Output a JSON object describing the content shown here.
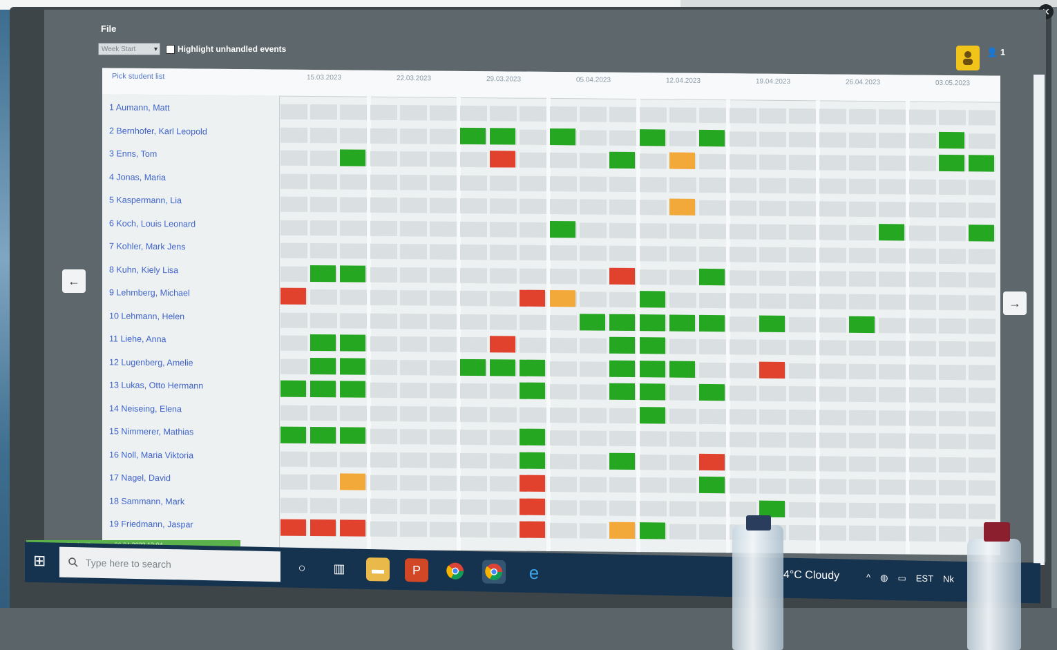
{
  "app": {
    "title": "File",
    "dropdown_value": "Week Start",
    "highlight_label": "Highlight unhandled events",
    "user_count": "1"
  },
  "grid": {
    "corner_label": "Pick student list",
    "dates": [
      "15.03.2023",
      "22.03.2023",
      "29.03.2023",
      "05.04.2023",
      "12.04.2023",
      "19.04.2023",
      "26.04.2023",
      "03.05.2023"
    ],
    "students": [
      {
        "label": "1  Aumann, Matt"
      },
      {
        "label": "2  Bernhofer, Karl Leopold"
      },
      {
        "label": "3  Enns, Tom"
      },
      {
        "label": "4  Jonas, Maria"
      },
      {
        "label": "5  Kaspermann, Lia"
      },
      {
        "label": "6  Koch, Louis Leonard"
      },
      {
        "label": "7  Kohler, Mark Jens"
      },
      {
        "label": "8  Kuhn, Kiely Lisa"
      },
      {
        "label": "9  Lehmberg, Michael"
      },
      {
        "label": "10  Lehmann, Helen"
      },
      {
        "label": "11  Liehe, Anna"
      },
      {
        "label": "12  Lugenberg, Amelie"
      },
      {
        "label": "13  Lukas, Otto Hermann"
      },
      {
        "label": "14  Neiseing, Elena"
      },
      {
        "label": "15  Nimmerer, Mathias"
      },
      {
        "label": "16  Noll, Maria Viktoria"
      },
      {
        "label": "17  Nagel, David"
      },
      {
        "label": "18  Sammann, Mark"
      },
      {
        "label": "19  Friedmann, Jaspar"
      }
    ],
    "events": [
      [],
      [
        [
          "green",
          6
        ],
        [
          "green",
          7
        ],
        [
          "green",
          9
        ],
        [
          "green",
          9
        ],
        [
          "green",
          12
        ],
        [
          "green",
          14
        ],
        [
          "green",
          22
        ]
      ],
      [
        [
          "green",
          2
        ],
        [
          "red",
          7
        ],
        [
          "red",
          7
        ],
        [
          "green",
          11
        ],
        [
          "orange",
          13
        ],
        [
          "green",
          22
        ],
        [
          "green",
          23
        ]
      ],
      [],
      [
        [
          "orange",
          13
        ]
      ],
      [
        [
          "green",
          9
        ],
        [
          "green",
          20
        ],
        [
          "green",
          23
        ]
      ],
      [],
      [
        [
          "green",
          1
        ],
        [
          "green",
          2
        ],
        [
          "red",
          11
        ],
        [
          "green",
          14
        ]
      ],
      [
        [
          "red",
          0
        ],
        [
          "red",
          8
        ],
        [
          "orange",
          9
        ],
        [
          "green",
          12
        ]
      ],
      [
        [
          "green",
          10
        ],
        [
          "green",
          11
        ],
        [
          "green",
          12
        ],
        [
          "green",
          13
        ],
        [
          "green",
          14
        ],
        [
          "green",
          16
        ],
        [
          "green",
          19
        ]
      ],
      [
        [
          "green",
          1
        ],
        [
          "green",
          2
        ],
        [
          "red",
          7
        ],
        [
          "green",
          11
        ],
        [
          "green",
          12
        ]
      ],
      [
        [
          "green",
          1
        ],
        [
          "green",
          2
        ],
        [
          "green",
          6
        ],
        [
          "green",
          7
        ],
        [
          "green",
          8
        ],
        [
          "green",
          11
        ],
        [
          "green",
          12
        ],
        [
          "green",
          13
        ],
        [
          "red",
          16
        ]
      ],
      [
        [
          "green",
          0
        ],
        [
          "green",
          1
        ],
        [
          "green",
          2
        ],
        [
          "green",
          8
        ],
        [
          "green",
          11
        ],
        [
          "green",
          12
        ],
        [
          "green",
          14
        ]
      ],
      [
        [
          "green",
          12
        ]
      ],
      [
        [
          "green",
          0
        ],
        [
          "green",
          1
        ],
        [
          "green",
          2
        ],
        [
          "green",
          8
        ]
      ],
      [
        [
          "green",
          8
        ],
        [
          "green",
          11
        ],
        [
          "red",
          14
        ]
      ],
      [
        [
          "orange",
          2
        ],
        [
          "red",
          8
        ],
        [
          "green",
          14
        ]
      ],
      [
        [
          "red",
          8
        ],
        [
          "green",
          16
        ]
      ],
      [
        [
          "red",
          0
        ],
        [
          "red",
          1
        ],
        [
          "red",
          2
        ],
        [
          "red",
          8
        ],
        [
          "orange",
          11
        ],
        [
          "green",
          12
        ]
      ]
    ]
  },
  "status_bar": {
    "text": "Last synchronized with server: 26.04.2023 12:04"
  },
  "taskbar": {
    "search_placeholder": "Type here to search",
    "weather": "4°C  Cloudy",
    "tray_lang": "EST",
    "tray_extra": "Nk"
  },
  "icons": {
    "nav_prev": "arrow-left-icon",
    "nav_next": "arrow-right-icon",
    "start": "windows-start-icon",
    "search": "search-icon",
    "cortana": "cortana-icon",
    "taskview": "task-view-icon",
    "explorer": "file-explorer-icon",
    "powerpoint": "powerpoint-icon",
    "chrome": "chrome-icon",
    "chrome2": "chrome-profile-icon",
    "edge": "edge-icon",
    "user": "user-badge-icon",
    "close": "close-icon"
  },
  "colors": {
    "event_green": "#26a722",
    "event_red": "#e0422e",
    "event_orange": "#f2a93a",
    "taskbar": "#15324f",
    "accent_badge": "#f0c419"
  }
}
